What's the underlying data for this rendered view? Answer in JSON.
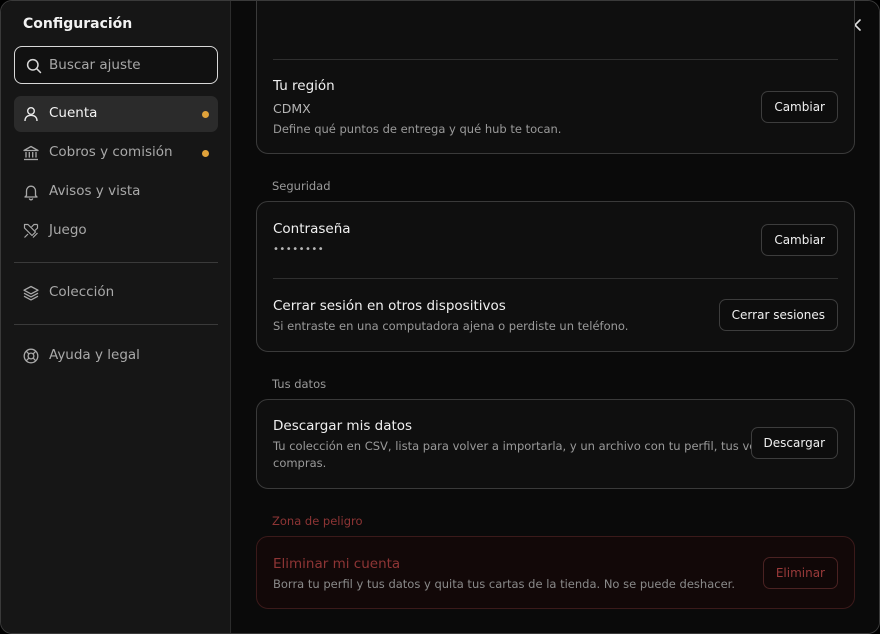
{
  "sidebar": {
    "title": "Configuración",
    "search_placeholder": "Buscar ajuste",
    "items": [
      {
        "label": "Cuenta",
        "icon": "user-icon",
        "active": true,
        "dot": true
      },
      {
        "label": "Cobros y comisión",
        "icon": "bank-icon",
        "active": false,
        "dot": true
      },
      {
        "label": "Avisos y vista",
        "icon": "bell-icon",
        "active": false,
        "dot": false
      },
      {
        "label": "Juego",
        "icon": "swords-icon",
        "active": false,
        "dot": false
      },
      {
        "label": "Colección",
        "icon": "layers-icon",
        "active": false,
        "dot": false
      },
      {
        "label": "Ayuda y legal",
        "icon": "lifebuoy-icon",
        "active": false,
        "dot": false
      }
    ],
    "dot_color": "#e0a23a"
  },
  "main": {
    "region": {
      "title": "Tu región",
      "value": "CDMX",
      "description": "Define qué puntos de entrega y qué hub te tocan.",
      "button": "Cambiar"
    },
    "security": {
      "label": "Seguridad",
      "password_title": "Contraseña",
      "password_value": "••••••••",
      "password_button": "Cambiar",
      "sessions_title": "Cerrar sesión en otros dispositivos",
      "sessions_description": "Si entraste en una computadora ajena o perdiste un teléfono.",
      "sessions_button": "Cerrar sesiones"
    },
    "data": {
      "label": "Tus datos",
      "title": "Descargar mis datos",
      "description_line1": "Tu colección en CSV, lista para volver a importarla, y un archivo con tu perfil, tus ventas y tus",
      "description_line2": "compras.",
      "button": "Descargar"
    },
    "danger": {
      "label": "Zona de peligro",
      "title": "Eliminar mi cuenta",
      "description": "Borra tu perfil y tus datos y quita tus cartas de la tienda. No se puede deshacer.",
      "button": "Eliminar",
      "color": "#8e3535"
    }
  }
}
